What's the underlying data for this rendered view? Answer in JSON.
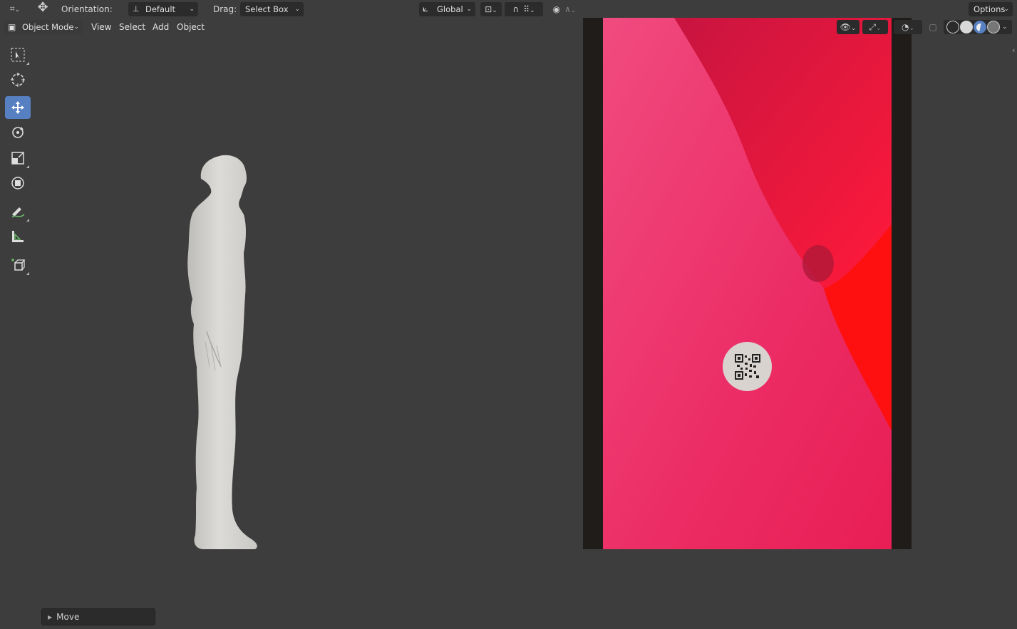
{
  "header": {
    "orientation_label": "Orientation:",
    "orientation_value": "Default",
    "drag_label": "Drag:",
    "drag_value": "Select Box",
    "transform_space": "Global",
    "options_label": "Options"
  },
  "viewport_header": {
    "mode": "Object Mode",
    "menus": [
      "View",
      "Select",
      "Add",
      "Object"
    ]
  },
  "toolbar": {
    "tools": [
      "select-box",
      "cursor",
      "move",
      "rotate",
      "scale",
      "transform",
      "annotate",
      "measure",
      "add-cube"
    ],
    "active": "move"
  },
  "last_operator": {
    "label": "Move"
  },
  "colors": {
    "viewport_bg": "#3d3d3d",
    "active_tool": "#5680c2",
    "camera_background_pink": "#e8306a",
    "camera_background_red": "#ff1010"
  }
}
